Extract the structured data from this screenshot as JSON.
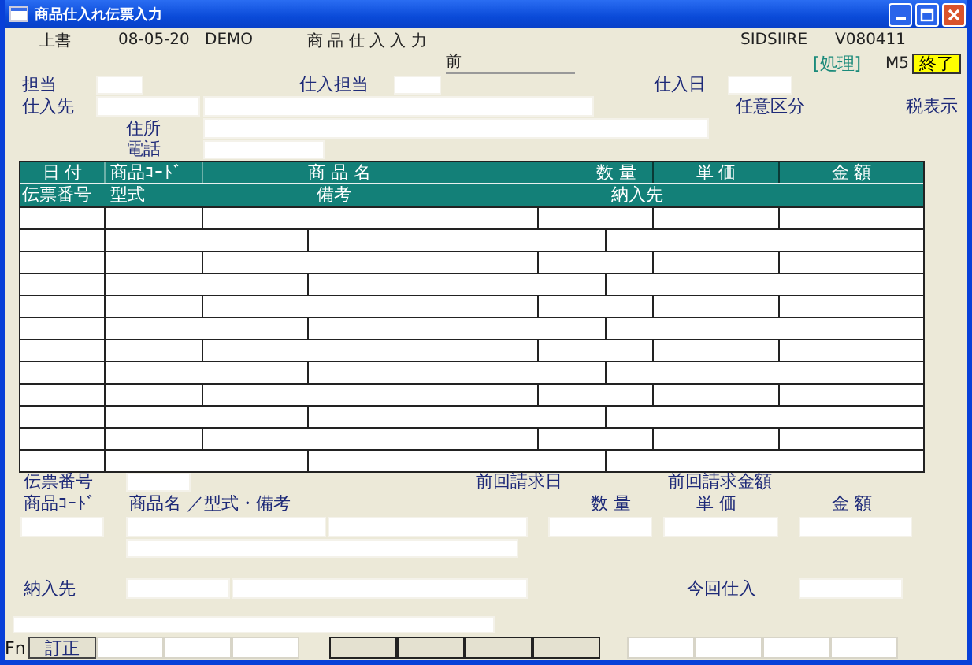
{
  "window": {
    "title": "商品仕入れ伝票入力"
  },
  "header": {
    "mode": "上書",
    "date": "08-05-20",
    "user": "DEMO",
    "title": "商 品 仕 入 入 力",
    "program": "SIDSIIRE",
    "version": "V080411",
    "prev": "前",
    "process": "[処理]",
    "process_code": "M5",
    "exit_button": "終了"
  },
  "form": {
    "staff": "担当",
    "purchase_staff": "仕入担当",
    "purchase_date": "仕入日",
    "supplier": "仕入先",
    "optional_category": "任意区分",
    "tax_display": "税表示",
    "address": "住所",
    "phone": "電話"
  },
  "table": {
    "columns": [
      "日 付",
      "商品ｺｰﾄﾞ",
      "商 品 名",
      "数 量",
      "単 価",
      "金 額"
    ],
    "subcolumns": [
      "伝票番号",
      "型式",
      "備考",
      "納入先"
    ],
    "rows": [
      {
        "kind": "main"
      },
      {
        "kind": "sub"
      },
      {
        "kind": "main"
      },
      {
        "kind": "sub"
      },
      {
        "kind": "main"
      },
      {
        "kind": "sub"
      },
      {
        "kind": "main"
      },
      {
        "kind": "sub"
      },
      {
        "kind": "main"
      },
      {
        "kind": "sub"
      },
      {
        "kind": "main"
      },
      {
        "kind": "sub"
      }
    ]
  },
  "entry": {
    "slip_no": "伝票番号",
    "last_billing_date": "前回請求日",
    "last_billing_amount": "前回請求金額",
    "product_code": "商品ｺｰﾄﾞ",
    "product_name": "商品名 ／型式・備考",
    "quantity": "数 量",
    "unit_price": "単 価",
    "amount": "金 額",
    "delivery": "納入先",
    "current_purchase": "今回仕入"
  },
  "function_bar": {
    "label": "Fn",
    "keys": [
      {
        "label": "訂正"
      }
    ]
  }
}
